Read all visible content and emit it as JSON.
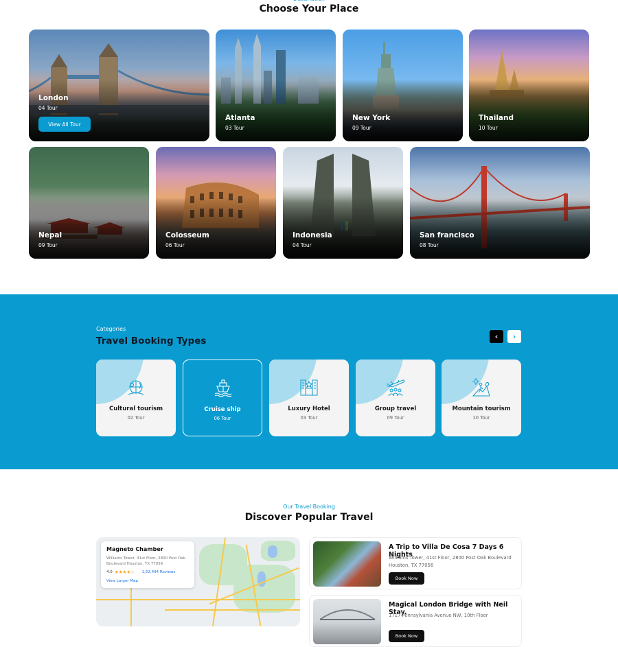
{
  "destination": {
    "eyebrow": "Destination",
    "title": "Choose Your Place",
    "view_all_label": "View All Tour",
    "places": [
      {
        "name": "London",
        "tours": "04 Tour"
      },
      {
        "name": "Atlanta",
        "tours": "03 Tour"
      },
      {
        "name": "New York",
        "tours": "09 Tour"
      },
      {
        "name": "Thailand",
        "tours": "10 Tour"
      },
      {
        "name": "Nepal",
        "tours": "09 Tour"
      },
      {
        "name": "Colosseum",
        "tours": "06 Tour"
      },
      {
        "name": "Indonesia",
        "tours": "04 Tour"
      },
      {
        "name": "San francisco",
        "tours": "08 Tour"
      }
    ]
  },
  "categories": {
    "eyebrow": "Categories",
    "title": "Travel Booking Types",
    "prev_icon": "‹",
    "next_icon": "›",
    "items": [
      {
        "name": "Cultural tourism",
        "tours": "02 Tour",
        "icon": "cultural-tourism-icon"
      },
      {
        "name": "Cruise ship",
        "tours": "06 Tour",
        "icon": "cruise-ship-icon",
        "active": true
      },
      {
        "name": "Luxury Hotel",
        "tours": "03 Tour",
        "icon": "luxury-hotel-icon"
      },
      {
        "name": "Group travel",
        "tours": "09 Tour",
        "icon": "group-travel-icon"
      },
      {
        "name": "Mountain tourism",
        "tours": "10 Tour",
        "icon": "mountain-tourism-icon"
      }
    ]
  },
  "discover": {
    "eyebrow": "Our Travel Booking",
    "title": "Discover Popular Travel",
    "map": {
      "place": "Magneto Chamber",
      "address": "Williams Tower, 41st Floor, 2800 Post Oak Boulevard Houston, TX 77056",
      "rating": "4.0",
      "stars": "★★★★☆",
      "reviews": "1,52,494 Reviews",
      "larger_map": "View Larger Map"
    },
    "trips": [
      {
        "title": "A Trip to Villa De Cosa 7 Days 6 Nights",
        "address": "Williams Tower, 41st Floor, 2800 Post Oak Boulevard Houston, TX 77056",
        "button": "Book Now"
      },
      {
        "title": "Magical London Bridge with Neil Stay.",
        "address": "1717 Pennsylvania Avenue NW, 10th Floor",
        "button": "Book Now"
      }
    ]
  },
  "colors": {
    "accent": "#0a9bd0",
    "dark": "#111111",
    "card_bg": "#f4f4f4",
    "blob": "#a9dcee"
  }
}
